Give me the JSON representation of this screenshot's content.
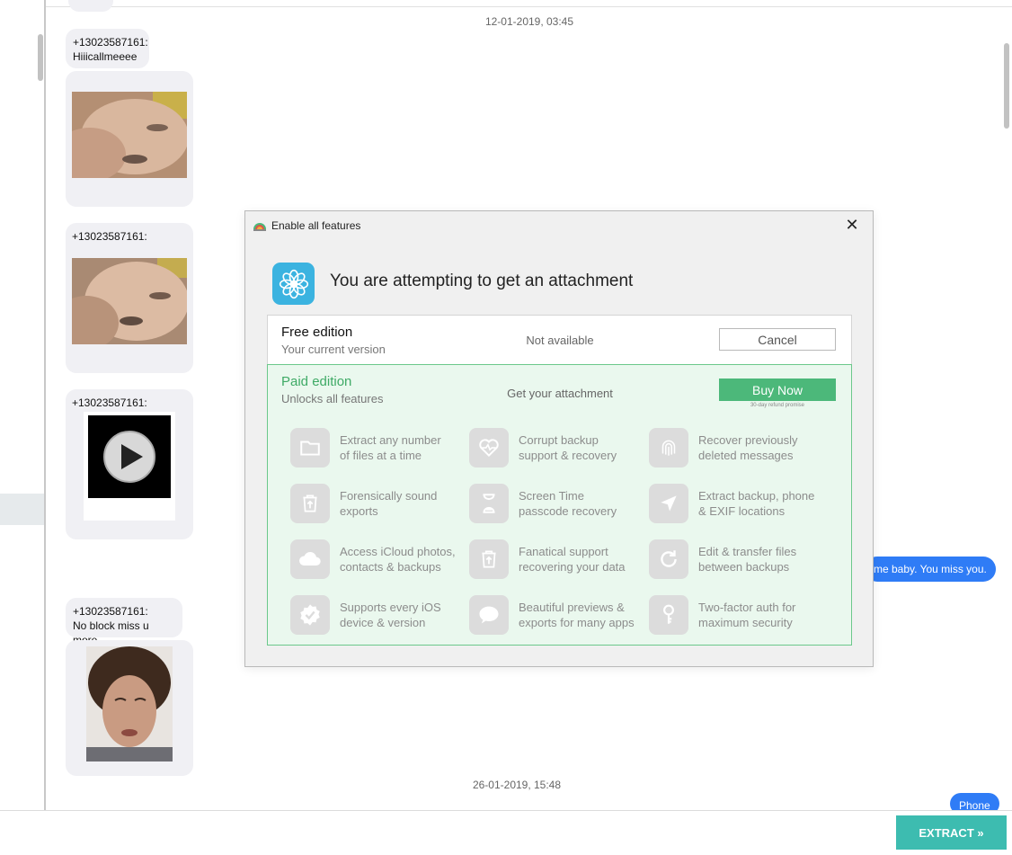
{
  "conversation": {
    "date_top": "12-01-2019, 03:45",
    "date_bottom": "26-01-2019, 15:48",
    "messages": [
      {
        "sender": "+13023587161:",
        "text": "Hiiicallmeeee"
      },
      {
        "sender": "+13023587161:"
      },
      {
        "sender": "+13023587161:"
      },
      {
        "sender": "+13023587161:",
        "text": "No block miss u more"
      }
    ],
    "outgoing": [
      {
        "text": "me baby. You miss you."
      },
      {
        "text": "Phone"
      }
    ]
  },
  "footer": {
    "extract_label": "EXTRACT »"
  },
  "dialog": {
    "title": "Enable all features",
    "heading": "You are attempting to get an attachment",
    "close_icon": "close-icon",
    "free": {
      "title": "Free edition",
      "subtitle": "Your current version",
      "status": "Not available",
      "button": "Cancel"
    },
    "paid": {
      "title": "Paid edition",
      "subtitle": "Unlocks all features",
      "status": "Get your attachment",
      "button": "Buy Now",
      "refund_note": "30-day refund promise",
      "accent": "#4cb87a"
    },
    "features": [
      {
        "icon": "folder-icon",
        "line1": "Extract any number",
        "line2": "of files at a time"
      },
      {
        "icon": "heart-pulse-icon",
        "line1": "Corrupt backup",
        "line2": "support & recovery"
      },
      {
        "icon": "fingerprint-icon",
        "line1": "Recover previously",
        "line2": "deleted messages"
      },
      {
        "icon": "trash-restore-icon",
        "line1": "Forensically sound",
        "line2": "exports"
      },
      {
        "icon": "hourglass-icon",
        "line1": "Screen Time",
        "line2": "passcode recovery"
      },
      {
        "icon": "location-arrow-icon",
        "line1": "Extract backup, phone",
        "line2": "& EXIF locations"
      },
      {
        "icon": "cloud-icon",
        "line1": "Access iCloud photos,",
        "line2": "contacts & backups"
      },
      {
        "icon": "trash-restore-icon",
        "line1": "Fanatical support",
        "line2": "recovering your data"
      },
      {
        "icon": "refresh-icon",
        "line1": "Edit & transfer files",
        "line2": "between backups"
      },
      {
        "icon": "badge-check-icon",
        "line1": "Supports every iOS",
        "line2": "device & version"
      },
      {
        "icon": "speech-bubble-icon",
        "line1": "Beautiful previews &",
        "line2": "exports for many apps"
      },
      {
        "icon": "key-icon",
        "line1": "Two-factor auth for",
        "line2": "maximum security"
      }
    ]
  },
  "colors": {
    "outgoing_bubble": "#2f7cf6",
    "extract_button": "#3dbcb0",
    "app_icon": "#3bb3e0"
  }
}
